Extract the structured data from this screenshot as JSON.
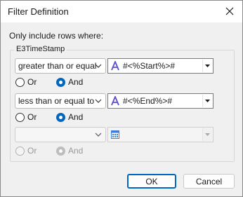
{
  "window": {
    "title": "Filter Definition"
  },
  "prompt": "Only include rows where:",
  "group": {
    "title": "E3TimeStamp",
    "conditions": [
      {
        "operator": "greater than or equal",
        "value": "#<%Start%>#",
        "value_icon": "text-field-icon",
        "logic": {
          "or": "Or",
          "and": "And",
          "selected": "And"
        }
      },
      {
        "operator": "less than or equal to",
        "value": "#<%End%>#",
        "value_icon": "text-field-icon",
        "logic": {
          "or": "Or",
          "and": "And",
          "selected": "And"
        }
      },
      {
        "operator": "",
        "value": "",
        "value_icon": "calendar-icon",
        "disabled": true,
        "logic": {
          "or": "Or",
          "and": "And",
          "selected": "And"
        }
      }
    ]
  },
  "buttons": {
    "ok": "OK",
    "cancel": "Cancel"
  },
  "colors": {
    "accent": "#0067c0",
    "icon_purple": "#5a4fcf",
    "calendar_blue": "#3b7ddd"
  }
}
